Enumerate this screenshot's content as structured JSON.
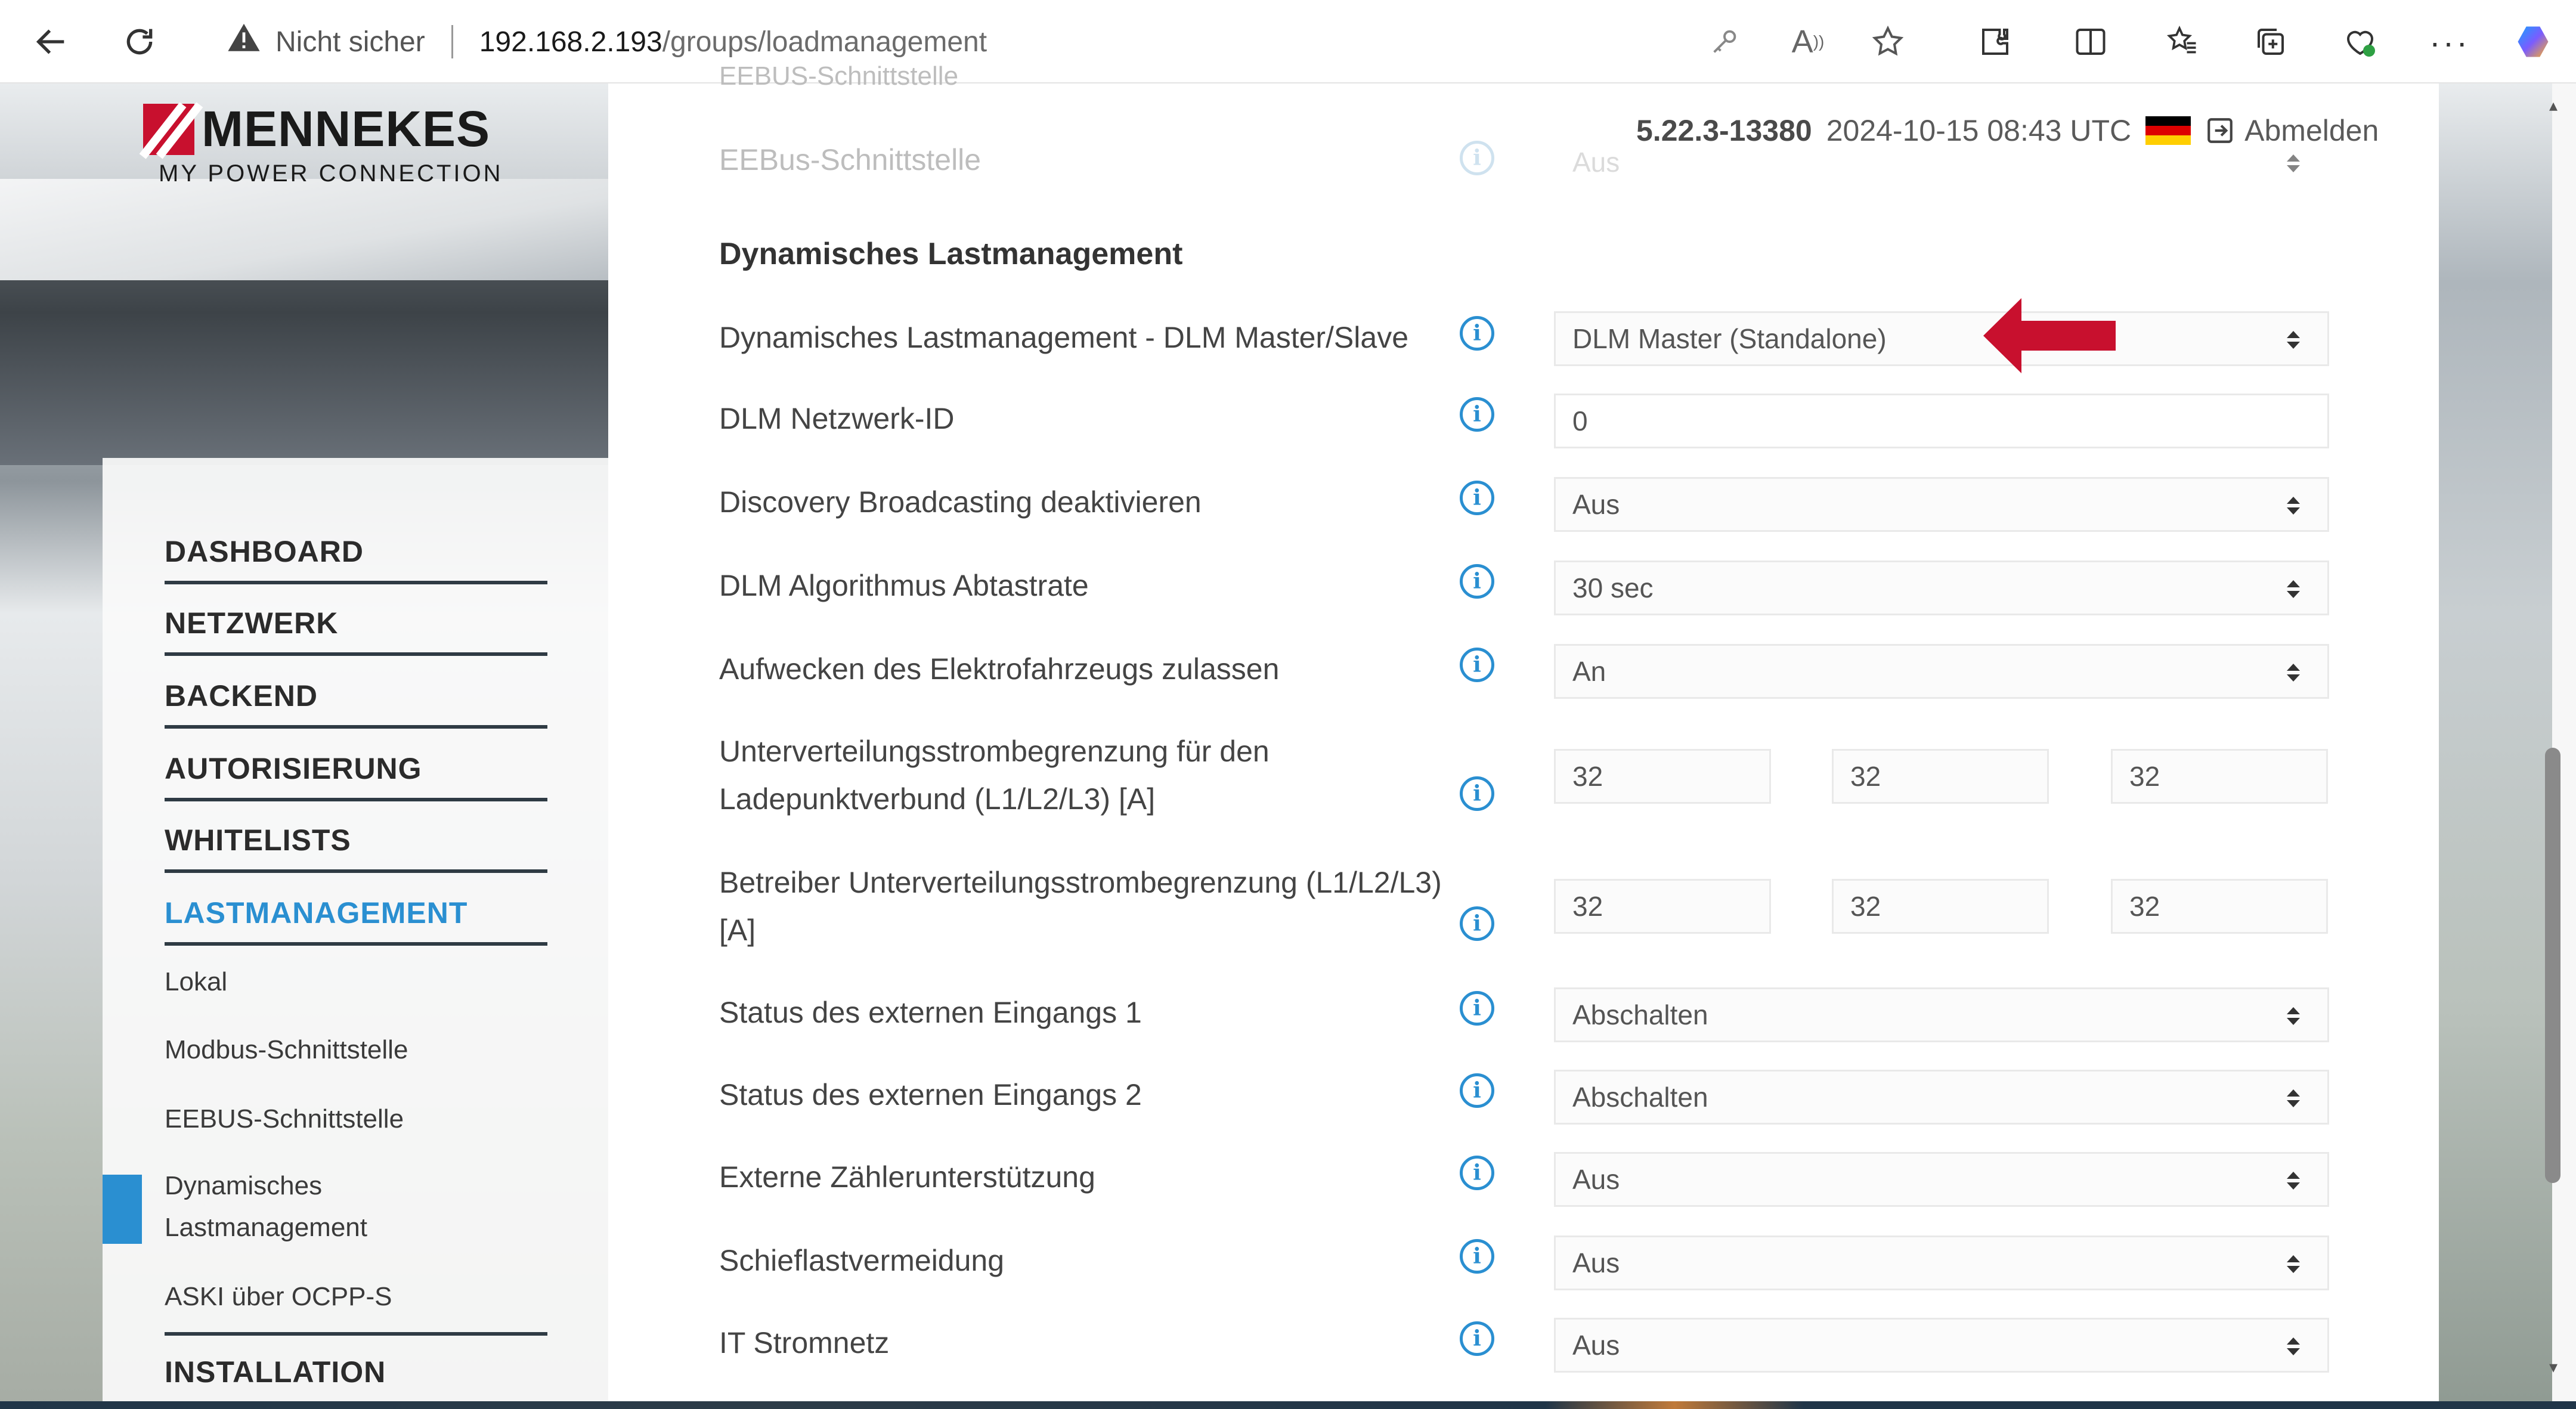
{
  "browser": {
    "security_label": "Nicht sicher",
    "url_host": "192.168.2.193",
    "url_path": "/groups/loadmanagement",
    "icons": [
      "back-icon",
      "reload-icon",
      "warning-icon",
      "key-icon",
      "read-aloud-icon",
      "favorite-star-icon",
      "extensions-icon",
      "split-screen-icon",
      "favorites-icon",
      "collections-icon",
      "browser-essentials-icon",
      "more-icon",
      "copilot-icon"
    ]
  },
  "brand": {
    "name": "MENNEKES",
    "tagline": "MY POWER CONNECTION",
    "color": "#c8102e"
  },
  "header": {
    "version": "5.22.3-13380",
    "datetime": "2024-10-15 08:43 UTC",
    "language_flag": "de-flag-icon",
    "logout_label": "Abmelden"
  },
  "nav": {
    "main": [
      {
        "label": "DASHBOARD"
      },
      {
        "label": "NETZWERK"
      },
      {
        "label": "BACKEND"
      },
      {
        "label": "AUTORISIERUNG"
      },
      {
        "label": "WHITELISTS"
      },
      {
        "label": "LASTMANAGEMENT",
        "active": true
      },
      {
        "label": "INSTALLATION"
      }
    ],
    "sub": [
      {
        "label": "Lokal"
      },
      {
        "label": "Modbus-Schnittstelle"
      },
      {
        "label": "EEBUS-Schnittstelle"
      },
      {
        "label": "Dynamisches Lastmanagement",
        "active": true
      },
      {
        "label": "ASKI über OCPP-S"
      }
    ],
    "accent_color": "#2a8fd1"
  },
  "content": {
    "faded_top_label": "EEBUS-Schnittstelle",
    "eebus_row": {
      "label": "EEBus-Schnittstelle",
      "value": "Aus"
    },
    "section_title": "Dynamisches Lastmanagement",
    "rows": [
      {
        "label": "Dynamisches Lastmanagement - DLM Master/Slave",
        "type": "select",
        "value": "DLM Master (Standalone)"
      },
      {
        "label": "DLM Netzwerk-ID",
        "type": "input",
        "value": "0"
      },
      {
        "label": "Discovery Broadcasting deaktivieren",
        "type": "select",
        "value": "Aus"
      },
      {
        "label": "DLM Algorithmus Abtastrate",
        "type": "select",
        "value": "30 sec"
      },
      {
        "label": "Aufwecken des Elektrofahrzeugs zulassen",
        "type": "select",
        "value": "An"
      },
      {
        "label_line1": "Unterverteilungsstrombegrenzung für den",
        "label_line2": "Ladepunktverbund (L1/L2/L3) [A]",
        "type": "triple",
        "values": [
          "32",
          "32",
          "32"
        ]
      },
      {
        "label_line1": "Betreiber Unterverteilungsstrombegrenzung (L1/L2/L3)",
        "label_line2": "[A]",
        "type": "triple",
        "values": [
          "32",
          "32",
          "32"
        ]
      },
      {
        "label": "Status des externen Eingangs 1",
        "type": "select",
        "value": "Abschalten"
      },
      {
        "label": "Status des externen Eingangs 2",
        "type": "select",
        "value": "Abschalten"
      },
      {
        "label": "Externe Zählerunterstützung",
        "type": "select",
        "value": "Aus"
      },
      {
        "label": "Schieflastvermeidung",
        "type": "select",
        "value": "Aus"
      },
      {
        "label": "IT Stromnetz",
        "type": "select",
        "value": "Aus"
      }
    ],
    "info_icon_glyph": "i",
    "highlight_arrow_color": "#c8102e"
  }
}
